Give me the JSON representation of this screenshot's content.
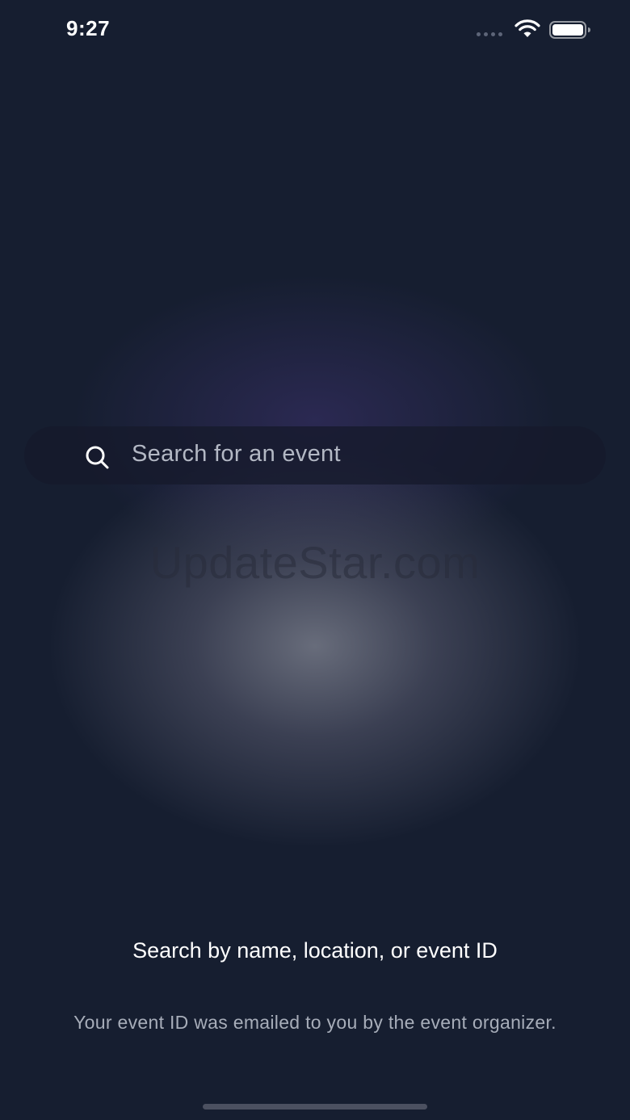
{
  "status_bar": {
    "time": "9:27"
  },
  "search": {
    "placeholder": "Search for an event",
    "icon": "search-icon"
  },
  "watermark": {
    "text": "UpdateStar.com"
  },
  "help": {
    "title": "Search by name, location, or event ID",
    "subtitle": "Your event ID was emailed to you by the event organizer."
  },
  "colors": {
    "background": "#161e30",
    "glow": "#767a88",
    "search_bar": "#161a2c",
    "placeholder_text": "#b3b8c4",
    "subtitle_text": "#a7adb9"
  }
}
